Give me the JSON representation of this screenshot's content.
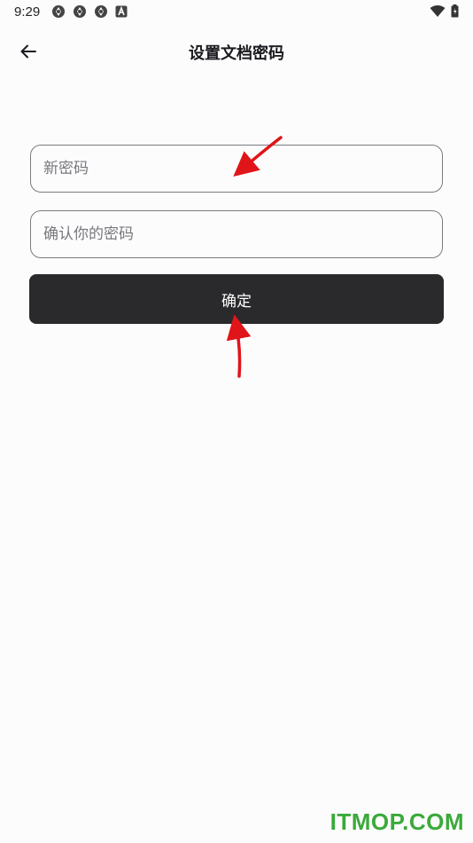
{
  "status_bar": {
    "time": "9:29",
    "notification_icons": [
      "aperture-icon",
      "aperture-icon",
      "aperture-icon",
      "a-box-icon"
    ],
    "wifi_icon": "wifi-icon",
    "battery_icon": "battery-icon"
  },
  "app_bar": {
    "back_icon": "arrow-left-icon",
    "title": "设置文档密码"
  },
  "form": {
    "new_password": {
      "value": "",
      "placeholder": "新密码"
    },
    "confirm_password": {
      "value": "",
      "placeholder": "确认你的密码"
    },
    "confirm_button_label": "确定"
  },
  "colors": {
    "background": "#fdfcfd",
    "button_background": "#2a2a2c",
    "button_text": "#ffffff",
    "field_border": "#7a7a80",
    "annotation_arrow": "#e0151a",
    "watermark": "#3aaa3a"
  },
  "watermark": "ITMOP.COM"
}
